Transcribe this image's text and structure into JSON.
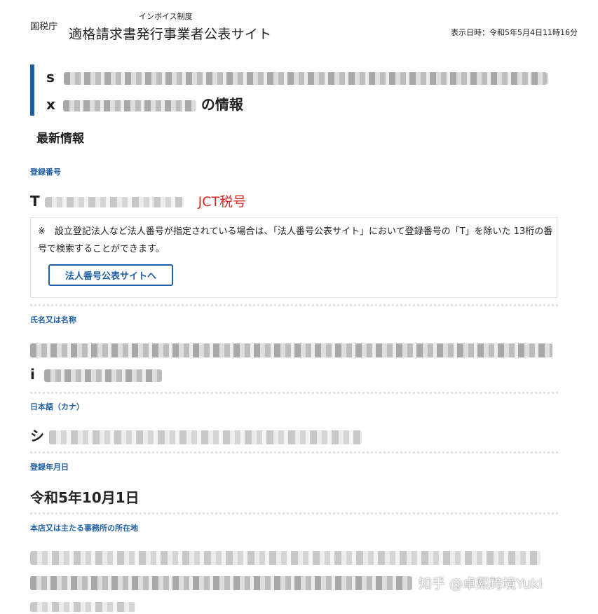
{
  "header": {
    "agency": "国税庁",
    "site_sub": "インボイス制度",
    "site_title": "適格請求書発行事業者公表サイト",
    "display_time": "表示日時：令和5年5月4日11時16分"
  },
  "hero": {
    "line1_prefix": "s",
    "line2_prefix": "x",
    "line2_suffix": "の情報"
  },
  "section_title": "最新情報",
  "registration": {
    "label": "登録番号",
    "value_prefix": "T",
    "annotation": "JCT税号"
  },
  "note": {
    "text": "※　設立登記法人など法人番号が指定されている場合は、「法人番号公表サイト」において登録番号の「T」を除いた 13桁の番号で検索することができます。",
    "button_label": "法人番号公表サイトへ"
  },
  "name": {
    "label": "氏名又は名称",
    "line2_prefix": "i"
  },
  "kana": {
    "label": "日本語（カナ）",
    "value_prefix": "シ"
  },
  "reg_date": {
    "label": "登録年月日",
    "value": "令和5年10月1日"
  },
  "address": {
    "label": "本店又は主たる事務所の所在地"
  },
  "watermark": "知乎 @卓熙跨境Yuki",
  "colors": {
    "accent": "#1f5fa8",
    "annotation": "#d6281e",
    "divider": "#e1e1e1"
  }
}
